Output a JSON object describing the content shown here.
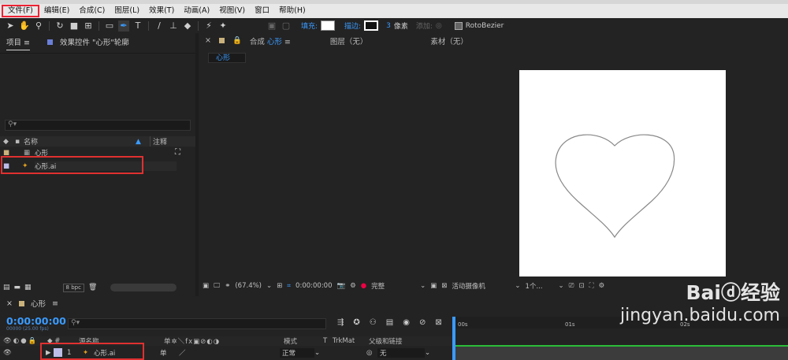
{
  "menu": [
    "文件(F)",
    "编辑(E)",
    "合成(C)",
    "图层(L)",
    "效果(T)",
    "动画(A)",
    "视图(V)",
    "窗口",
    "帮助(H)"
  ],
  "toolbar": {
    "fill_label": "填充:",
    "stroke_label": "描边:",
    "stroke_value": "3",
    "stroke_unit": "像素",
    "add_label": "添加:",
    "rotobezier_label": "RotoBezier"
  },
  "project_panel": {
    "tab_project": "项目",
    "tab_effects": "效果控件 \"心形\"轮廓",
    "col_name": "名称",
    "col_comment": "注释",
    "items": [
      {
        "name": "心形"
      },
      {
        "name": "心形.ai"
      }
    ],
    "bpc": "8 bpc"
  },
  "comp_panel": {
    "tab_comp": "合成",
    "comp_name": "心形",
    "tab_layer": "图层（无）",
    "tab_footage": "素材（无）",
    "sub_tab": "心形",
    "zoom": "(67.4%)",
    "time": "0:00:00:00",
    "quality": "完整",
    "camera": "活动摄像机",
    "views": "1个..."
  },
  "timeline": {
    "comp_name": "心形",
    "timecode": "0:00:00:00",
    "fps": "00000 (25.00 fps)",
    "col_source": "源名称",
    "col_mode": "模式",
    "col_t": "T",
    "col_trkmat": "TrkMat",
    "col_parent": "父级和链接",
    "ruler": [
      "00s",
      "01s",
      "02s"
    ],
    "layer": {
      "number": "1",
      "name": "心形.ai",
      "mode": "正常",
      "parent": "无"
    }
  },
  "watermark": {
    "brand": "Bai",
    "brand2": "经验",
    "url": "jingyan.baidu.com"
  },
  "colors": {
    "accent": "#3a9bff",
    "highlight": "#e03030",
    "track_green": "#2bbd3a"
  }
}
